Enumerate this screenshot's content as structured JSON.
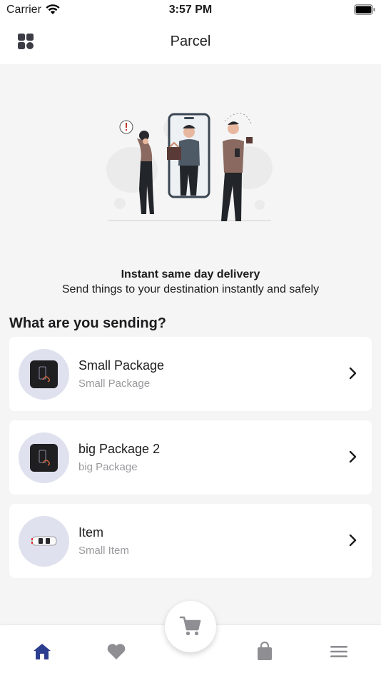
{
  "status_bar": {
    "carrier": "Carrier",
    "time": "3:57 PM"
  },
  "nav": {
    "title": "Parcel"
  },
  "hero": {
    "headline": "Instant same day delivery",
    "subline": "Send things to your destination instantly and safely"
  },
  "section": {
    "title": "What are you sending?"
  },
  "items": [
    {
      "name": "Small Package",
      "desc": "Small Package",
      "icon": "package-photo"
    },
    {
      "name": "big Package 2",
      "desc": "big Package",
      "icon": "package-photo"
    },
    {
      "name": "Item",
      "desc": "Small Item",
      "icon": "car-photo"
    }
  ],
  "tab_bar": {
    "tabs": [
      "home-icon",
      "heart-icon",
      "cart-icon",
      "bag-icon",
      "menu-icon"
    ],
    "active_color": "#2c3e8f",
    "inactive_color": "#8e8e93"
  }
}
